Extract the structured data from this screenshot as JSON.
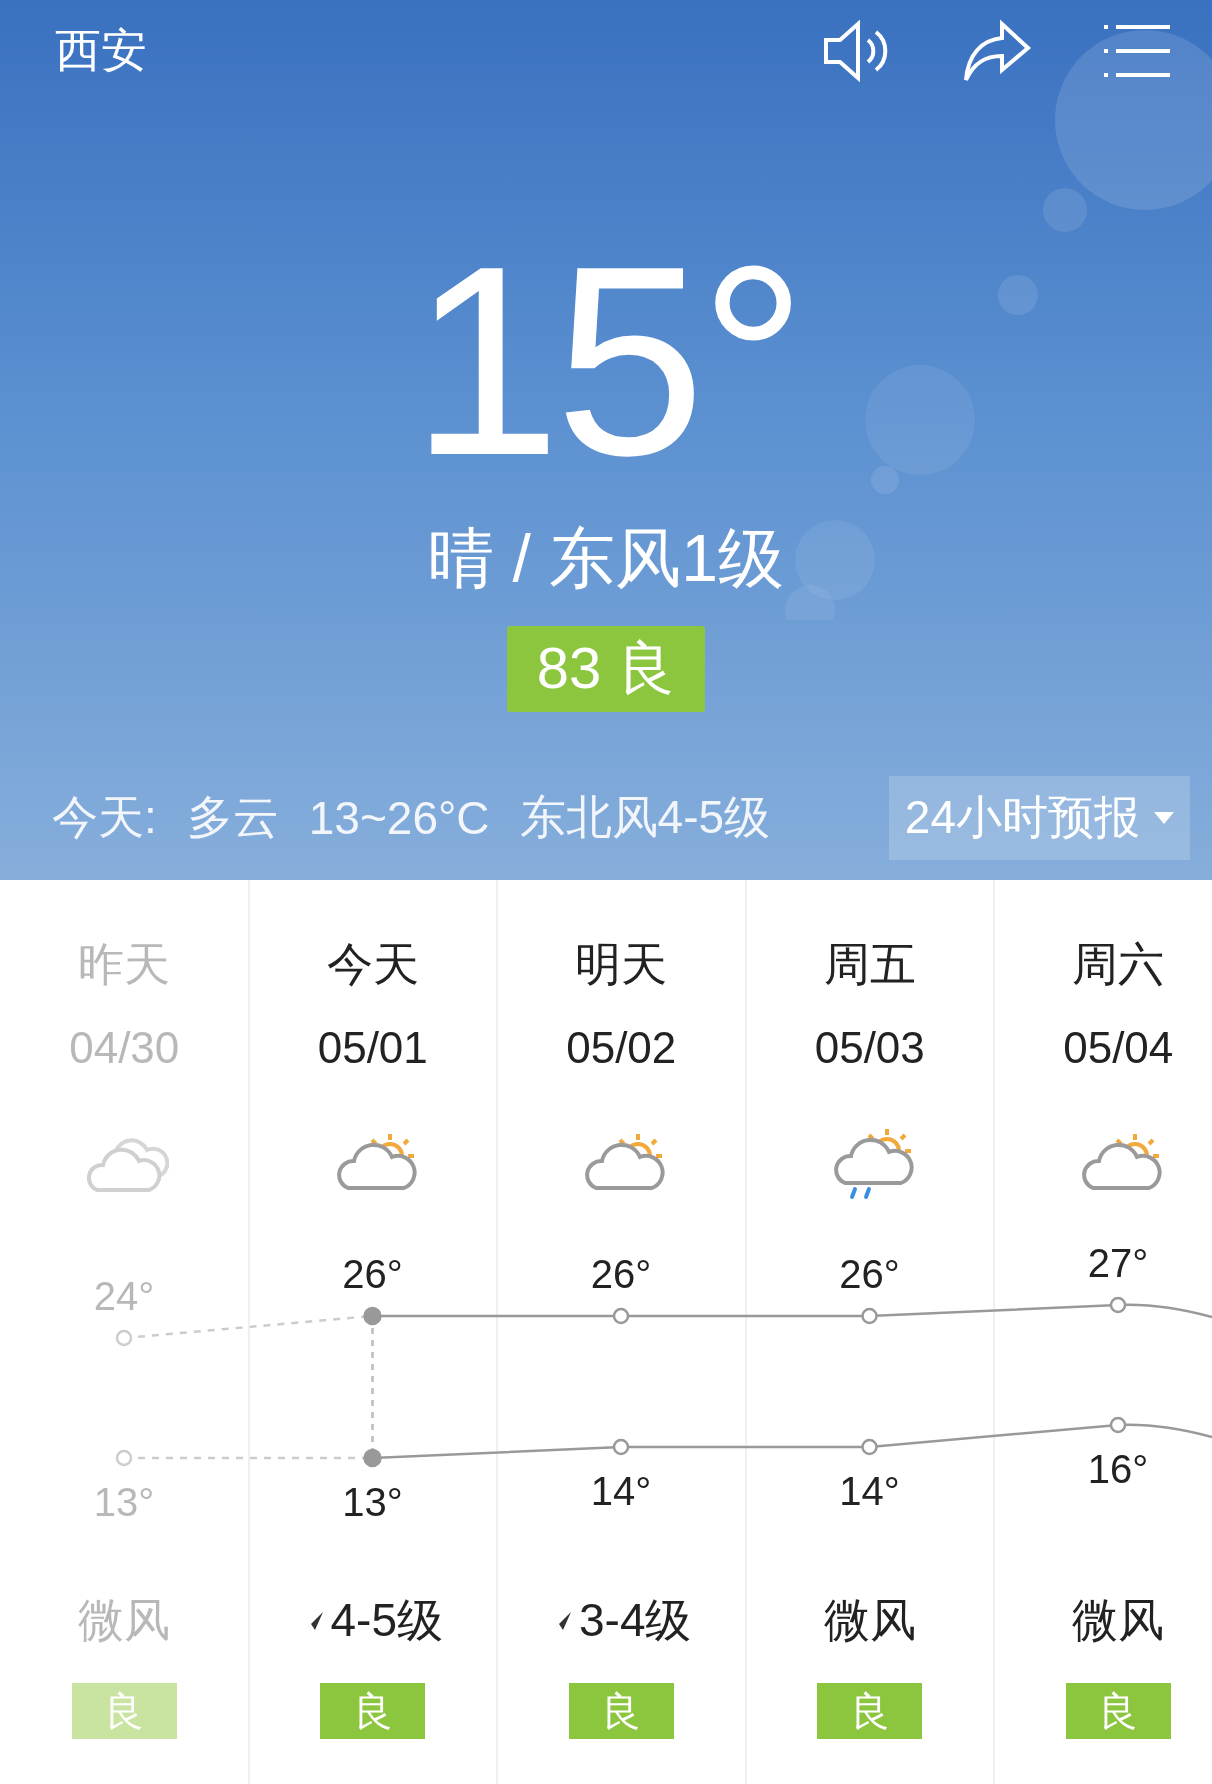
{
  "header": {
    "city": "西安"
  },
  "current": {
    "temperature": "15°",
    "condition": "晴 / 东风1级",
    "aqi": "83 良"
  },
  "today_bar": {
    "label": "今天:",
    "weather": "多云",
    "range": "13~26°C",
    "wind": "东北风4-5级",
    "forecast_button": "24小时预报"
  },
  "days": [
    {
      "name": "昨天",
      "date": "04/30",
      "kind": "cloudy",
      "high": "24°",
      "low": "13°",
      "wind": "微风",
      "wind_arrow": false,
      "aqi": "良",
      "past": true,
      "current": false
    },
    {
      "name": "今天",
      "date": "05/01",
      "kind": "partly-cloudy",
      "high": "26°",
      "low": "13°",
      "wind": "4-5级",
      "wind_arrow": true,
      "aqi": "良",
      "past": false,
      "current": true
    },
    {
      "name": "明天",
      "date": "05/02",
      "kind": "partly-cloudy",
      "high": "26°",
      "low": "14°",
      "wind": "3-4级",
      "wind_arrow": true,
      "aqi": "良",
      "past": false,
      "current": false
    },
    {
      "name": "周五",
      "date": "05/03",
      "kind": "shower",
      "high": "26°",
      "low": "14°",
      "wind": "微风",
      "wind_arrow": false,
      "aqi": "良",
      "past": false,
      "current": false
    },
    {
      "name": "周六",
      "date": "05/04",
      "kind": "partly-cloudy",
      "high": "27°",
      "low": "16°",
      "wind": "微风",
      "wind_arrow": false,
      "aqi": "良",
      "past": false,
      "current": false
    }
  ]
}
